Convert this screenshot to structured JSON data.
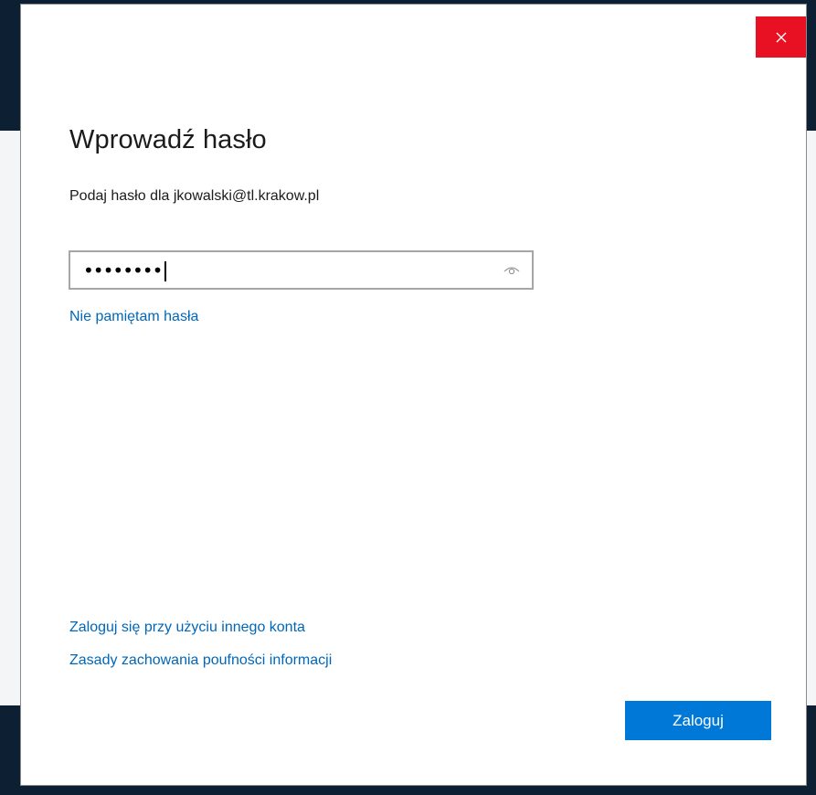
{
  "dialog": {
    "title": "Wprowadź hasło",
    "subtitle": "Podaj hasło dla jkowalski@tl.krakow.pl",
    "close_icon": "close-icon",
    "close_color": "#e81123"
  },
  "password": {
    "masked_value": "••••••••",
    "reveal_icon": "eye-icon"
  },
  "links": {
    "forgot": "Nie pamiętam hasła",
    "other_account": "Zaloguj się przy użyciu innego konta",
    "privacy": "Zasady zachowania poufności informacji",
    "color": "#0067b8"
  },
  "buttons": {
    "signin_label": "Zaloguj",
    "signin_color": "#0078d7"
  }
}
